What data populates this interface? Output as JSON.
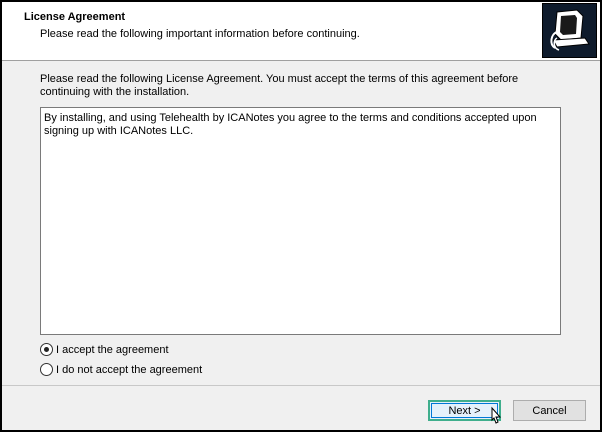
{
  "header": {
    "title": "License Agreement",
    "subtitle": "Please read the following important information before continuing."
  },
  "instructions": "Please read the following License Agreement. You must accept the terms of this agreement before continuing with the installation.",
  "license_text": "By installing, and using Telehealth by ICANotes you agree to the terms and conditions accepted upon signing up with ICANotes LLC.",
  "options": {
    "accept": "I accept the agreement",
    "decline": "I do not accept the agreement",
    "selected": "accept"
  },
  "buttons": {
    "next": "Next >",
    "cancel": "Cancel"
  },
  "colors": {
    "focus_highlight": "#3fae8c",
    "logo_background": "#0e1b2c"
  },
  "icons": {
    "logo": "installer-computer-logo",
    "cursor": "mouse-pointer-icon"
  }
}
